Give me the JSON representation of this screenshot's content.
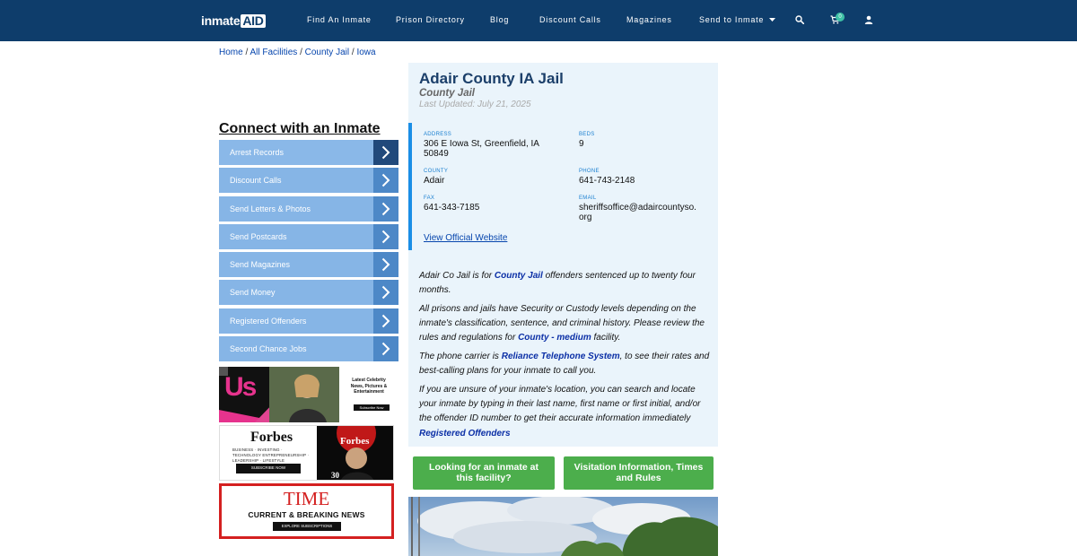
{
  "nav": {
    "logo_main": "inmate",
    "logo_accent": "AID",
    "links": [
      "Find An Inmate",
      "Prison Directory",
      "Blog",
      "Discount Calls",
      "Magazines",
      "Send to Inmate"
    ],
    "cart_count": "0",
    "icons": [
      "search-icon",
      "cart-icon",
      "user-icon"
    ]
  },
  "breadcrumb": {
    "items": [
      "Home",
      "All Facilities",
      "County Jail",
      "Iowa"
    ],
    "separator": "/"
  },
  "sidebar": {
    "title": "Connect with an Inmate",
    "items": [
      "Arrest Records",
      "Discount Calls",
      "Send Letters & Photos",
      "Send Postcards",
      "Send Magazines",
      "Send Money",
      "Registered Offenders",
      "Second Chance Jobs"
    ]
  },
  "ads": {
    "us": {
      "logo": "Us",
      "tagline": "Latest Celebrity News, Pictures & Entertainment",
      "cta": "Subscribe Now"
    },
    "forbes": {
      "logo": "Forbes",
      "tagline": "BUSINESS · INVESTING · TECHNOLOGY ENTREPRENEURSHIP · LEADERSHIP · LIFESTYLE",
      "cta": "SUBSCRIBE NOW",
      "cover_logo": "Forbes",
      "cover_number": "30"
    },
    "time": {
      "logo": "TIME",
      "tagline": "CURRENT & BREAKING NEWS",
      "cta": "EXPLORE SUBSCRIPTIONS"
    }
  },
  "facility": {
    "name": "Adair County IA Jail",
    "type": "County Jail",
    "updated": "Last Updated: July 21, 2025",
    "address_label": "ADDRESS",
    "address": "306 E Iowa St, Greenfield, IA 50849",
    "beds_label": "BEDS",
    "beds": "9",
    "county_label": "COUNTY",
    "county": "Adair",
    "phone_label": "PHONE",
    "phone": "641-743-2148",
    "fax_label": "FAX",
    "fax": "641-343-7185",
    "email_label": "EMAIL",
    "email_line1": "sheriffsoffice@adaircountyso.",
    "email_line2": "org",
    "website_link": "View Official Website"
  },
  "description": {
    "p1_a": "Adair Co Jail is for ",
    "p1_link": "County Jail",
    "p1_b": " offenders sentenced up to twenty four months.",
    "p2_a": "All prisons and jails have Security or Custody levels depending on the inmate's classification, sentence, and criminal history. Please review the rules and regulations for ",
    "p2_link": "County - medium",
    "p2_b": " facility.",
    "p3_a": "The phone carrier is ",
    "p3_link": "Reliance Telephone System",
    "p3_b": ", to see their rates and best-calling plans for your inmate to call you.",
    "p4_a": "If you are unsure of your inmate's location, you can search and locate your inmate by typing in their last name, first name or first initial, and/or the offender ID number to get their accurate information immediately ",
    "p4_link": "Registered Offenders"
  },
  "buttons": {
    "looking": "Looking for an inmate at this facility?",
    "visitation": "Visitation Information, Times and Rules"
  },
  "colors": {
    "nav_bg": "#0e3d6b",
    "menu_item": "#86b5e6",
    "menu_arrow": "#4d88c7",
    "panel_bg": "#eaf4fb",
    "accent_blue": "#1a8ee6",
    "green_button": "#4cae4c"
  }
}
